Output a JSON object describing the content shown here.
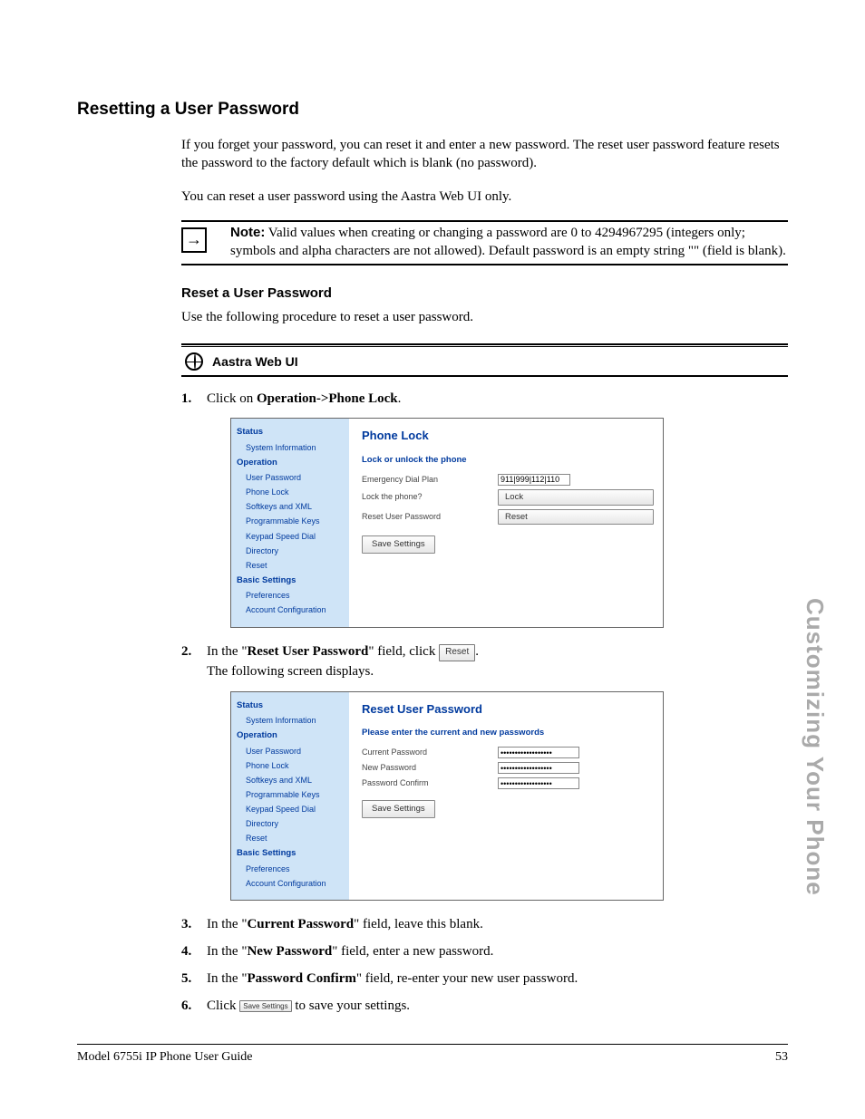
{
  "sideTab": "Customizing Your Phone",
  "h1": "Resetting a User Password",
  "intro1": "If you forget your password, you can reset it and enter a new password. The reset user password feature resets the password to the factory default which is blank (no password).",
  "intro2": "You can reset a user password using the Aastra Web UI only.",
  "note": {
    "label": "Note:",
    "text": " Valid values when creating or changing a password are 0 to 4294967295 (integers only; symbols and alpha characters are not allowed). Default password is an empty string \"\" (field is blank)."
  },
  "h2": "Reset a User Password",
  "h2para": "Use the following procedure to reset a user password.",
  "sectionBar": "Aastra Web UI",
  "steps": {
    "s1a": "Click on ",
    "s1b": "Operation->Phone Lock",
    "s1c": ".",
    "s2a": "In the \"",
    "s2b": "Reset User Password",
    "s2c": "\" field, click ",
    "s2btn": "Reset",
    "s2d": ".",
    "s2e": "The following screen displays.",
    "s3a": "In the \"",
    "s3b": "Current Password",
    "s3c": "\" field, leave this blank.",
    "s4a": "In the \"",
    "s4b": "New Password",
    "s4c": "\" field, enter a new password.",
    "s5a": "In the \"",
    "s5b": "Password Confirm",
    "s5c": "\" field, re-enter your new user password.",
    "s6a": "Click ",
    "s6btn": "Save Settings",
    "s6b": " to save your settings."
  },
  "nav": {
    "status": "Status",
    "sysinfo": "System Information",
    "operation": "Operation",
    "userpw": "User Password",
    "phonelock": "Phone Lock",
    "softkeys": "Softkeys and XML",
    "progkeys": "Programmable Keys",
    "speeddial": "Keypad Speed Dial",
    "directory": "Directory",
    "reset": "Reset",
    "basic": "Basic Settings",
    "prefs": "Preferences",
    "acct": "Account Configuration"
  },
  "shot1": {
    "title": "Phone Lock",
    "sub": "Lock or unlock the phone",
    "row1": "Emergency Dial Plan",
    "row1val": "911|999|112|110",
    "row2": "Lock the phone?",
    "row2btn": "Lock",
    "row3": "Reset User Password",
    "row3btn": "Reset",
    "save": "Save Settings"
  },
  "shot2": {
    "title": "Reset User Password",
    "sub": "Please enter the current and new passwords",
    "row1": "Current Password",
    "row2": "New Password",
    "row3": "Password Confirm",
    "dots": "••••••••••••••••••",
    "save": "Save Settings"
  },
  "footer": {
    "left": "Model 6755i IP Phone User Guide",
    "right": "53"
  }
}
